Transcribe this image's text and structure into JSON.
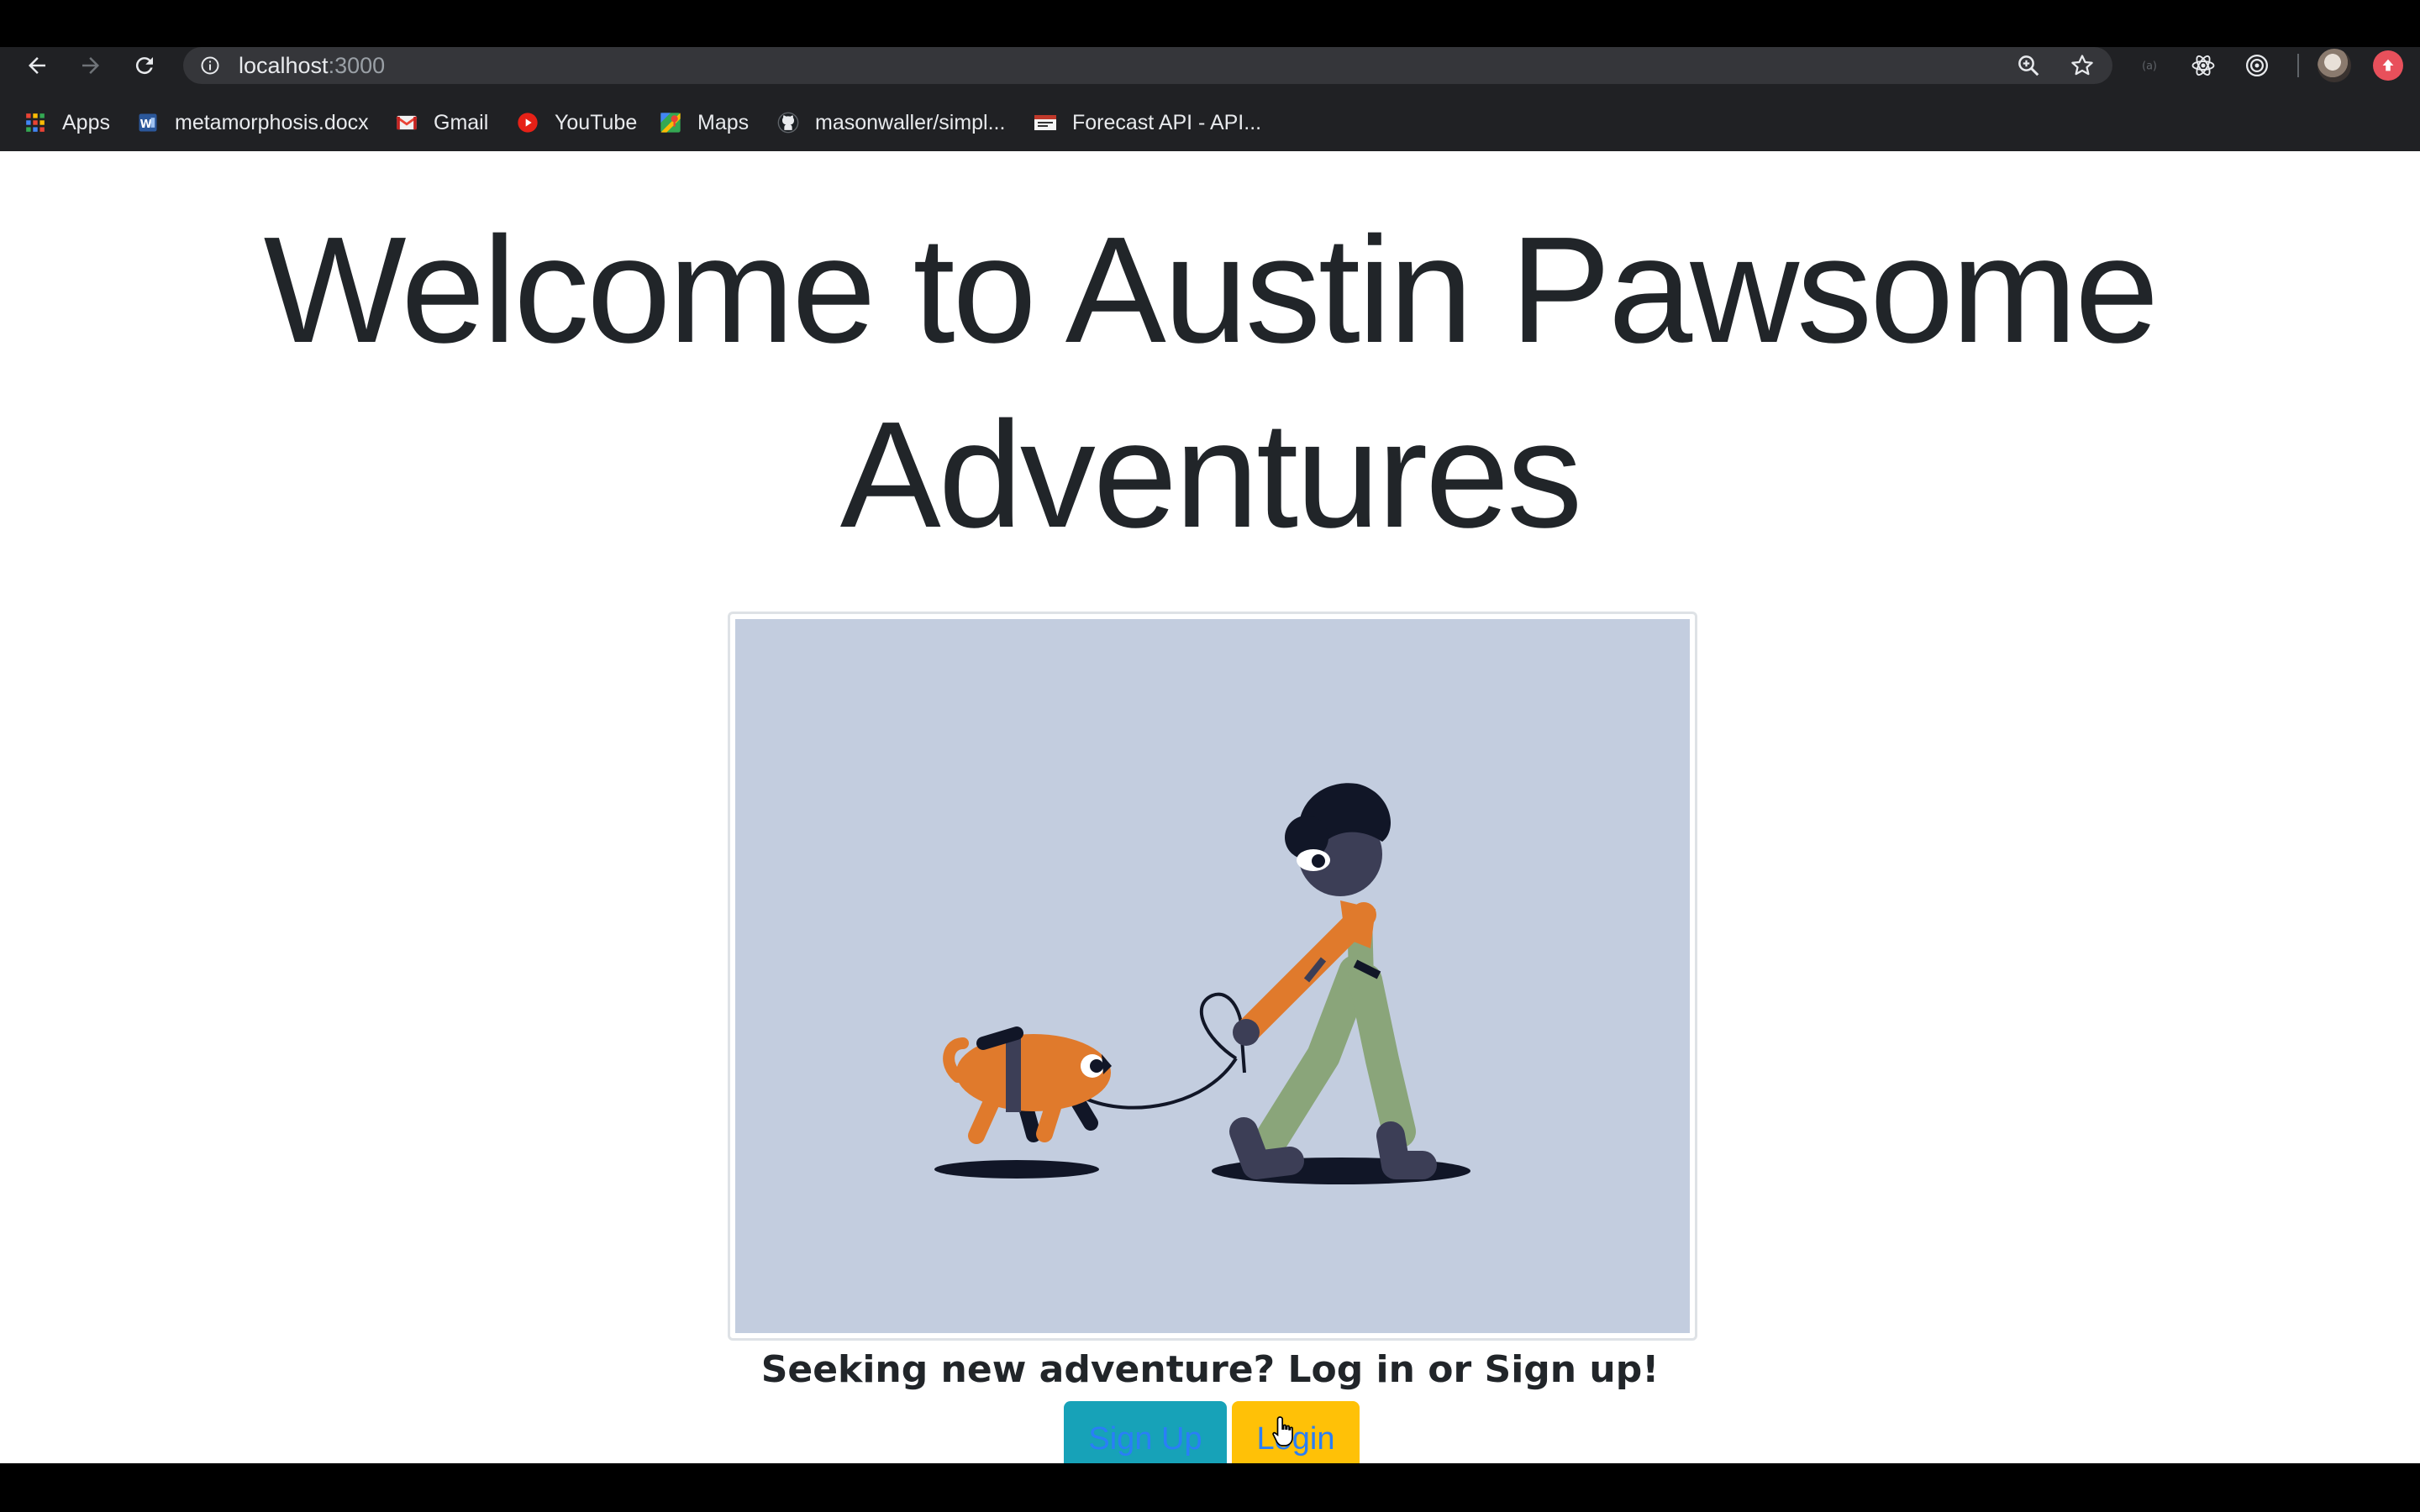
{
  "browser": {
    "url_host": "localhost",
    "url_port": ":3000"
  },
  "bookmarks": [
    {
      "label": "Apps",
      "icon": "apps-grid-icon"
    },
    {
      "label": "metamorphosis.docx",
      "icon": "word-doc-icon"
    },
    {
      "label": "Gmail",
      "icon": "gmail-icon"
    },
    {
      "label": "YouTube",
      "icon": "youtube-icon"
    },
    {
      "label": "Maps",
      "icon": "maps-icon"
    },
    {
      "label": "masonwaller/simpl...",
      "icon": "github-icon"
    },
    {
      "label": "Forecast API - API...",
      "icon": "forecast-api-icon"
    }
  ],
  "page": {
    "headline_line1": "Welcome to Austin Pawsome",
    "headline_line2": "Adventures",
    "tagline": "Seeking new adventure? Log in or Sign up!",
    "signup_label": "Sign Up",
    "login_label": "Login"
  },
  "colors": {
    "signup_button": "#17a2b8",
    "login_button": "#ffc107",
    "button_text": "#2a7ef7",
    "illustration_bg": "#c3cddf"
  }
}
